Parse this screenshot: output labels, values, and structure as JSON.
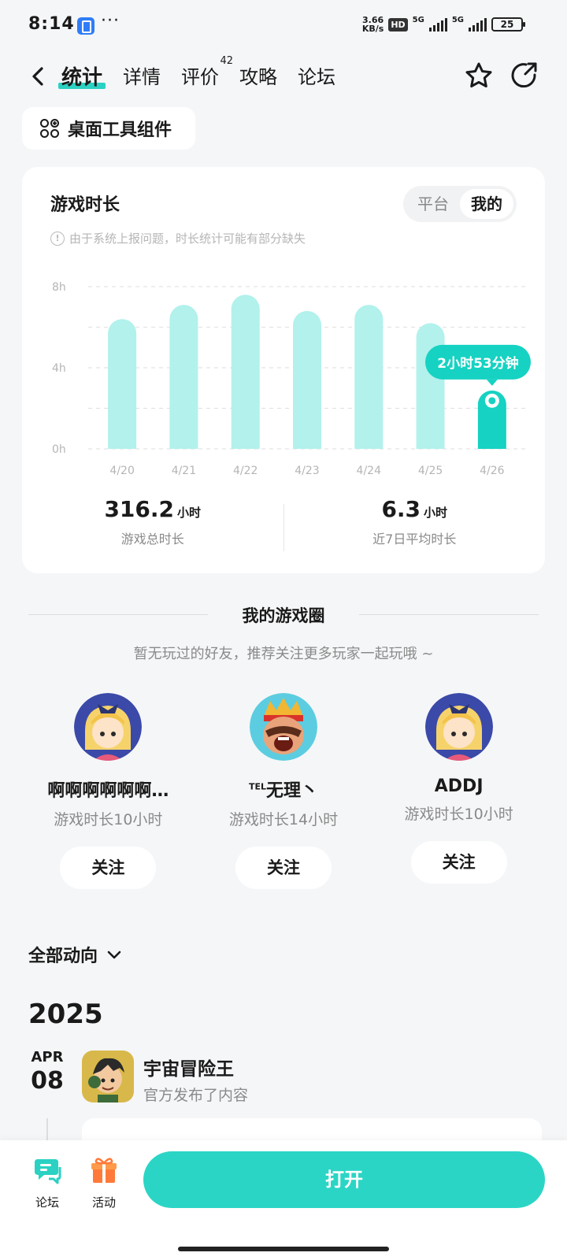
{
  "status_bar": {
    "time": "8:14",
    "net_speed_value": "3.66",
    "net_speed_unit": "KB/s",
    "hd_label": "HD",
    "sig1_label": "5G",
    "sig2_label": "5G",
    "battery": "25"
  },
  "nav": {
    "tabs": [
      {
        "label": "统计"
      },
      {
        "label": "详情"
      },
      {
        "label": "评价",
        "badge": "42"
      },
      {
        "label": "攻略"
      },
      {
        "label": "论坛"
      }
    ],
    "active_tab": "统计"
  },
  "widget_button": "桌面工具组件",
  "playtime_card": {
    "title": "游戏时长",
    "segments": [
      "平台",
      "我的"
    ],
    "active_segment": "我的",
    "notice": "由于系统上报问题，时长统计可能有部分缺失",
    "total_value": "316.2",
    "total_unit": "小时",
    "total_label": "游戏总时长",
    "avg_value": "6.3",
    "avg_unit": "小时",
    "avg_label": "近7日平均时长",
    "tooltip": "2小时53分钟"
  },
  "chart_data": {
    "type": "bar",
    "categories": [
      "4/20",
      "4/21",
      "4/22",
      "4/23",
      "4/24",
      "4/25",
      "4/26"
    ],
    "values": [
      6.4,
      7.1,
      7.6,
      6.8,
      7.1,
      6.2,
      2.88
    ],
    "y_tick_labels": [
      "0h",
      "4h",
      "8h"
    ],
    "ylim": [
      0,
      8
    ],
    "highlight_index": 6,
    "colors": {
      "bar": "#b2f1ec",
      "highlight": "#16d2c2",
      "grid": "#e3e3e3"
    }
  },
  "game_circle": {
    "title": "我的游戏圈",
    "subtitle": "暂无玩过的好友，推荐关注更多玩家一起玩哦 ~",
    "friends": [
      {
        "name": "啊啊啊啊啊啊…",
        "playtime": "游戏时长10小时",
        "follow": "关注"
      },
      {
        "name_prefix": "TEL",
        "name": "无理丶",
        "playtime": "游戏时长14小时",
        "follow": "关注"
      },
      {
        "name": "ADDJ",
        "playtime": "游戏时长10小时",
        "follow": "关注"
      }
    ]
  },
  "feed": {
    "filter": "全部动向",
    "year": "2025",
    "post": {
      "month": "APR",
      "day": "08",
      "title": "宇宙冒险王",
      "subtitle": "官方发布了内容"
    }
  },
  "bottom_bar": {
    "forum_label": "论坛",
    "activity_label": "活动",
    "open_label": "打开"
  }
}
